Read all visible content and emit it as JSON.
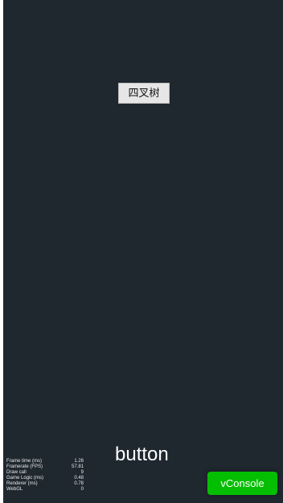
{
  "scene": {
    "background_color": "#1f272f"
  },
  "quadtree_button": {
    "label": "四叉树"
  },
  "bottom_label": {
    "text": "button"
  },
  "stats_panel": {
    "rows": [
      {
        "label": "Frame time (ms)",
        "value": "1.26"
      },
      {
        "label": "Framerate (FPS)",
        "value": "57.81"
      },
      {
        "label": "Draw call",
        "value": "9"
      },
      {
        "label": "Game Logic (ms)",
        "value": "0.48"
      },
      {
        "label": "Renderer (ms)",
        "value": "0.78"
      },
      {
        "label": "WebGL",
        "value": "0"
      }
    ]
  },
  "vconsole": {
    "label": "vConsole",
    "color": "#04be02"
  }
}
